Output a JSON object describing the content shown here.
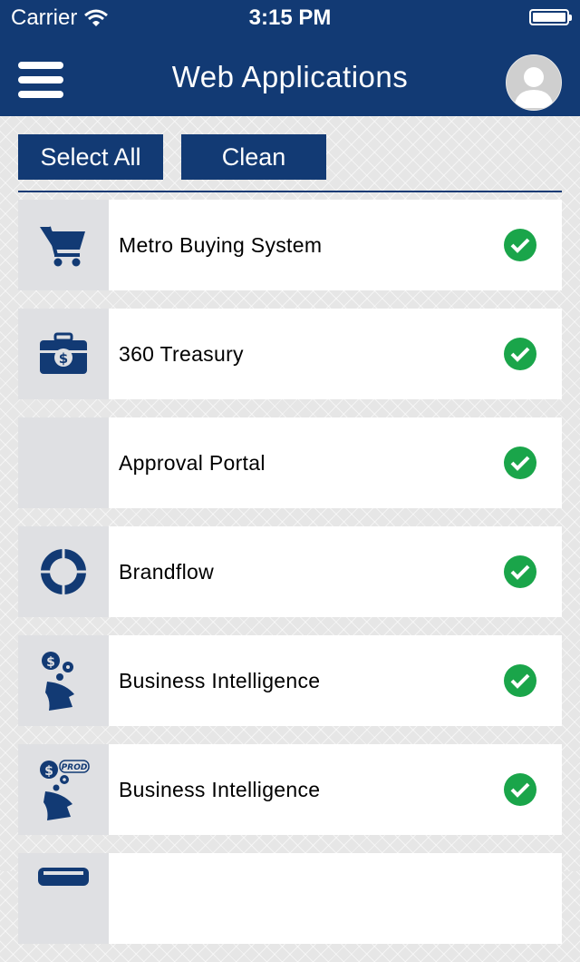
{
  "status_bar": {
    "carrier": "Carrier",
    "time": "3:15 PM"
  },
  "header": {
    "title": "Web Applications",
    "menu_icon": "hamburger-menu-icon",
    "avatar_icon": "user-avatar-icon"
  },
  "toolbar": {
    "select_all_label": "Select All",
    "clean_label": "Clean"
  },
  "apps": [
    {
      "label": "Metro Buying System",
      "icon": "shopping-cart-icon",
      "selected": true
    },
    {
      "label": "360 Treasury",
      "icon": "briefcase-dollar-icon",
      "selected": true
    },
    {
      "label": "Approval Portal",
      "icon": "",
      "selected": true
    },
    {
      "label": "Brandflow",
      "icon": "cycle-arrows-icon",
      "selected": true
    },
    {
      "label": "Business Intelligence",
      "icon": "business-intelligence-icon",
      "selected": true
    },
    {
      "label": "Business Intelligence",
      "icon": "business-intelligence-prod-icon",
      "icon_text": "PROD",
      "selected": true
    },
    {
      "label": "",
      "icon": "partial-app-icon",
      "selected": false
    }
  ],
  "colors": {
    "primary": "#123a74",
    "check": "#1aa54a",
    "icon_bg": "#dfe0e3",
    "row_bg": "#ffffff"
  }
}
